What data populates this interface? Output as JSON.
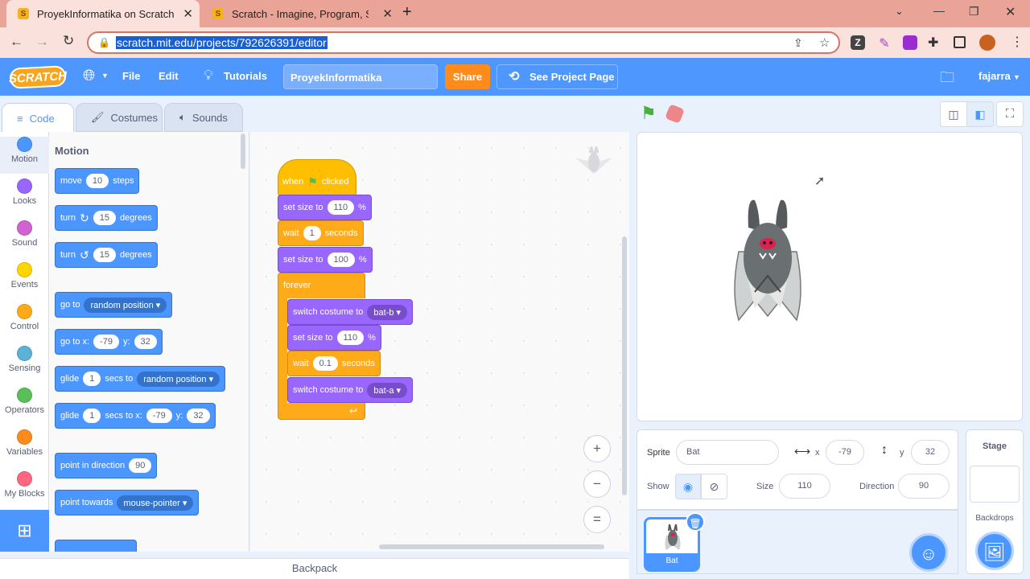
{
  "browser": {
    "tabs": [
      {
        "title": "ProyekInformatika on Scratch"
      },
      {
        "title": "Scratch - Imagine, Program, Shar"
      }
    ],
    "url": "scratch.mit.edu/projects/792626391/editor"
  },
  "menubar": {
    "logo": "SCRATCH",
    "file": "File",
    "edit": "Edit",
    "tutorials": "Tutorials",
    "project_title": "ProyekInformatika",
    "share": "Share",
    "see_project_page": "See Project Page",
    "username": "fajarra"
  },
  "editor_tabs": {
    "code": "Code",
    "costumes": "Costumes",
    "sounds": "Sounds"
  },
  "categories": [
    {
      "label": "Motion",
      "color": "#4c97ff"
    },
    {
      "label": "Looks",
      "color": "#9966ff"
    },
    {
      "label": "Sound",
      "color": "#cf63cf"
    },
    {
      "label": "Events",
      "color": "#ffd500"
    },
    {
      "label": "Control",
      "color": "#ffab19"
    },
    {
      "label": "Sensing",
      "color": "#5cb1d6"
    },
    {
      "label": "Operators",
      "color": "#59c059"
    },
    {
      "label": "Variables",
      "color": "#ff8c1a"
    },
    {
      "label": "My Blocks",
      "color": "#ff6680"
    }
  ],
  "palette": {
    "heading": "Motion",
    "move": {
      "a": "move",
      "n": "10",
      "b": "steps"
    },
    "turn_right": {
      "a": "turn",
      "n": "15",
      "b": "degrees"
    },
    "turn_left": {
      "a": "turn",
      "n": "15",
      "b": "degrees"
    },
    "goto": {
      "a": "go to",
      "d": "random position"
    },
    "gotoxy": {
      "a": "go to x:",
      "x": "-79",
      "b": "y:",
      "y": "32"
    },
    "glide": {
      "a": "glide",
      "n": "1",
      "b": "secs to",
      "d": "random position"
    },
    "glidexy": {
      "a": "glide",
      "n": "1",
      "b": "secs to x:",
      "x": "-79",
      "c": "y:",
      "y": "32"
    },
    "point_dir": {
      "a": "point in direction",
      "n": "90"
    },
    "point_towards": {
      "a": "point towards",
      "d": "mouse-pointer"
    }
  },
  "script": {
    "hat": {
      "a": "when",
      "b": "clicked"
    },
    "set_size1": {
      "a": "set size to",
      "n": "110",
      "b": "%"
    },
    "wait1": {
      "a": "wait",
      "n": "1",
      "b": "seconds"
    },
    "set_size2": {
      "a": "set size to",
      "n": "100",
      "b": "%"
    },
    "forever": "forever",
    "switch1": {
      "a": "switch costume to",
      "d": "bat-b"
    },
    "set_size3": {
      "a": "set size to",
      "n": "110",
      "b": "%"
    },
    "wait2": {
      "a": "wait",
      "n": "0.1",
      "b": "seconds"
    },
    "switch2": {
      "a": "switch costume to",
      "d": "bat-a"
    }
  },
  "zoom": {
    "in": "+",
    "out": "−",
    "reset": "="
  },
  "backpack": "Backpack",
  "sprite_info": {
    "sprite_label": "Sprite",
    "sprite_name": "Bat",
    "x_label": "x",
    "x": "-79",
    "y_label": "y",
    "y": "32",
    "show_label": "Show",
    "size_label": "Size",
    "size": "110",
    "direction_label": "Direction",
    "direction": "90"
  },
  "sprites": [
    {
      "name": "Bat"
    }
  ],
  "stage_pane": {
    "title": "Stage",
    "backdrops": "Backdrops"
  }
}
